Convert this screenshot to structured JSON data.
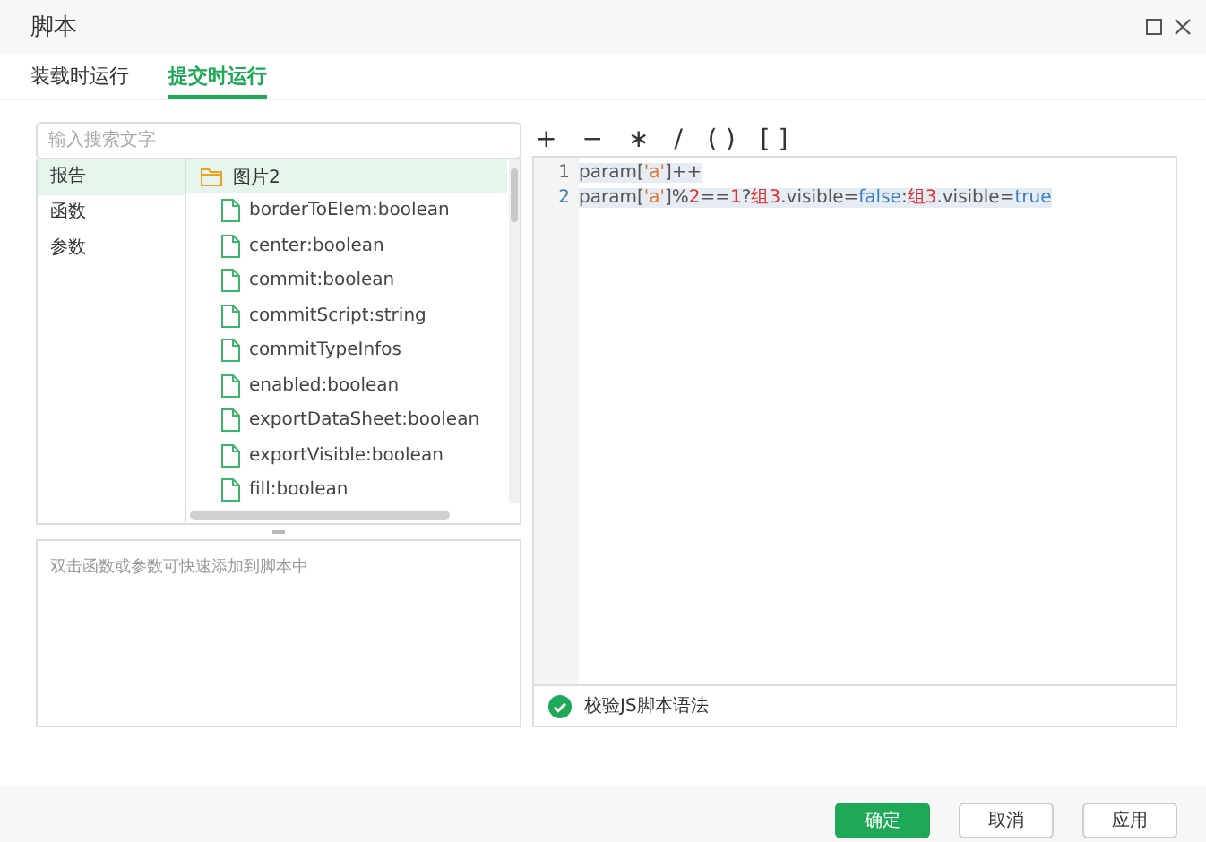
{
  "window": {
    "title": "脚本"
  },
  "tabs": [
    {
      "label": "装载时运行",
      "selected": false
    },
    {
      "label": "提交时运行",
      "selected": true
    }
  ],
  "search": {
    "placeholder": "输入搜索文字"
  },
  "categories": [
    {
      "label": "报告",
      "selected": true
    },
    {
      "label": "函数",
      "selected": false
    },
    {
      "label": "参数",
      "selected": false
    }
  ],
  "tree": {
    "label": "图片2",
    "selected": true,
    "children": [
      {
        "label": "borderToElem:boolean"
      },
      {
        "label": "center:boolean"
      },
      {
        "label": "commit:boolean"
      },
      {
        "label": "commitScript:string"
      },
      {
        "label": "commitTypeInfos"
      },
      {
        "label": "enabled:boolean"
      },
      {
        "label": "exportDataSheet:boolean"
      },
      {
        "label": "exportVisible:boolean"
      },
      {
        "label": "fill:boolean"
      }
    ]
  },
  "hint": "双击函数或参数可快速添加到脚本中",
  "operators": [
    "+",
    "−",
    "∗",
    "/",
    "( )",
    "[ ]"
  ],
  "code_lines": [
    {
      "number": "1",
      "tokens": [
        {
          "kind": "plain",
          "text": "param["
        },
        {
          "kind": "string",
          "text": "'a'"
        },
        {
          "kind": "plain",
          "text": "]++"
        }
      ]
    },
    {
      "number": "2",
      "tokens": [
        {
          "kind": "plain",
          "text": "param["
        },
        {
          "kind": "string",
          "text": "'a'"
        },
        {
          "kind": "plain",
          "text": "]%"
        },
        {
          "kind": "number",
          "text": "2"
        },
        {
          "kind": "plain",
          "text": "=="
        },
        {
          "kind": "number",
          "text": "1"
        },
        {
          "kind": "plain",
          "text": "?"
        },
        {
          "kind": "number",
          "text": "组3"
        },
        {
          "kind": "plain",
          "text": ".visible="
        },
        {
          "kind": "keyword",
          "text": "false"
        },
        {
          "kind": "plain",
          "text": ":"
        },
        {
          "kind": "number",
          "text": "组3"
        },
        {
          "kind": "plain",
          "text": ".visible="
        },
        {
          "kind": "keyword",
          "text": "true"
        }
      ]
    }
  ],
  "validate": {
    "label": "校验JS脚本语法",
    "ok": true
  },
  "buttons": [
    {
      "label": "确定",
      "kind": "primary"
    },
    {
      "label": "取消",
      "kind": "default"
    },
    {
      "label": "应用",
      "kind": "default"
    }
  ]
}
